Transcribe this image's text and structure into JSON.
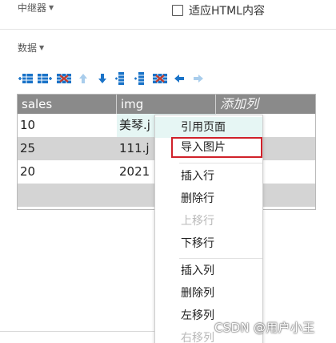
{
  "header": {
    "repeater_label": "中继器",
    "fit_html_label": "适应HTML内容"
  },
  "data_section": {
    "label": "数据"
  },
  "colors": {
    "accent": "#1a73c8",
    "delete": "#c0392b",
    "grid_header": "#8a8a8a",
    "highlight": "#e6f6f4",
    "outline": "#d0212a"
  },
  "toolbar": {
    "icons": [
      "insert-row-icon",
      "insert-column-icon",
      "delete-row-icon",
      "move-up-icon",
      "move-down-icon",
      "insert-column-left-icon",
      "insert-column-right-icon",
      "delete-column-icon",
      "move-left-icon",
      "move-right-icon"
    ]
  },
  "grid": {
    "columns": [
      "sales",
      "img",
      "添加列"
    ],
    "rows": [
      [
        "10",
        "美琴.j",
        ""
      ],
      [
        "25",
        "111.j",
        ""
      ],
      [
        "20",
        "2021",
        ""
      ],
      [
        "",
        "",
        ""
      ]
    ]
  },
  "context_menu": {
    "items": [
      {
        "label": "引用页面",
        "disabled": false
      },
      {
        "label": "导入图片",
        "disabled": false
      },
      {
        "label": "插入行",
        "disabled": false
      },
      {
        "label": "删除行",
        "disabled": false
      },
      {
        "label": "上移行",
        "disabled": true
      },
      {
        "label": "下移行",
        "disabled": false
      },
      {
        "label": "插入列",
        "disabled": false
      },
      {
        "label": "删除列",
        "disabled": false
      },
      {
        "label": "左移列",
        "disabled": false
      },
      {
        "label": "右移列",
        "disabled": true
      }
    ]
  },
  "watermark": "CSDN @用户小王"
}
